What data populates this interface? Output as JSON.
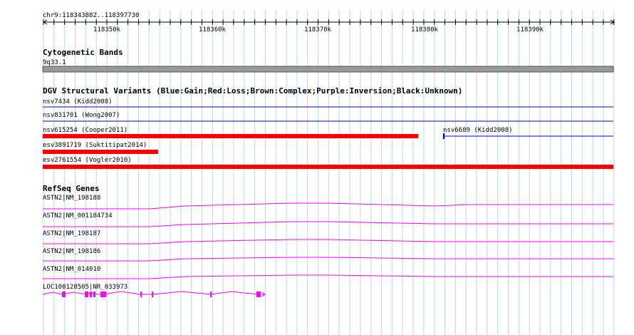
{
  "location": "chr9:118343882..118397730",
  "ruler": {
    "ticks": [
      "118350k",
      "118360k",
      "118370k",
      "118380k",
      "118390k"
    ]
  },
  "tracks": {
    "cytoband": {
      "title": "Cytogenetic Bands",
      "band": "9q33.1"
    },
    "dgv": {
      "title": "DGV Structural Variants (Blue:Gain;Red:Loss;Brown:Complex;Purple:Inversion;Black:Unknown)",
      "features": [
        {
          "label": "nsv7434 (Kidd2008)",
          "type": "Gain",
          "color": "#0000cc"
        },
        {
          "label": "nsv831701 (Wong2007)",
          "type": "Gain",
          "color": "#0000cc"
        },
        {
          "label": "nsv615254 (Cooper2011)",
          "type": "Loss",
          "color": "#ff0000"
        },
        {
          "label": "nsv6689 (Kidd2008)",
          "type": "Gain",
          "color": "#0000cc"
        },
        {
          "label": "esv3891719 (Suktitipat2014)",
          "type": "Loss",
          "color": "#ff0000"
        },
        {
          "label": "esv2761554 (Vogler2010)",
          "type": "Loss",
          "color": "#ff0000"
        }
      ]
    },
    "refseq": {
      "title": "RefSeq Genes",
      "color": "#ff00ff",
      "genes": [
        {
          "label": "ASTN2|NM_198188"
        },
        {
          "label": "ASTN2|NM_001184734"
        },
        {
          "label": "ASTN2|NM_198187"
        },
        {
          "label": "ASTN2|NM_198186"
        },
        {
          "label": "ASTN2|NM_014010"
        },
        {
          "label": "LOC100128505|NR_033973"
        }
      ]
    }
  },
  "colors": {
    "grid": "#bcd7ee",
    "gain": "#0000cc",
    "loss": "#ff0000",
    "gene": "#ff00ff",
    "cytoband": "#999999"
  }
}
